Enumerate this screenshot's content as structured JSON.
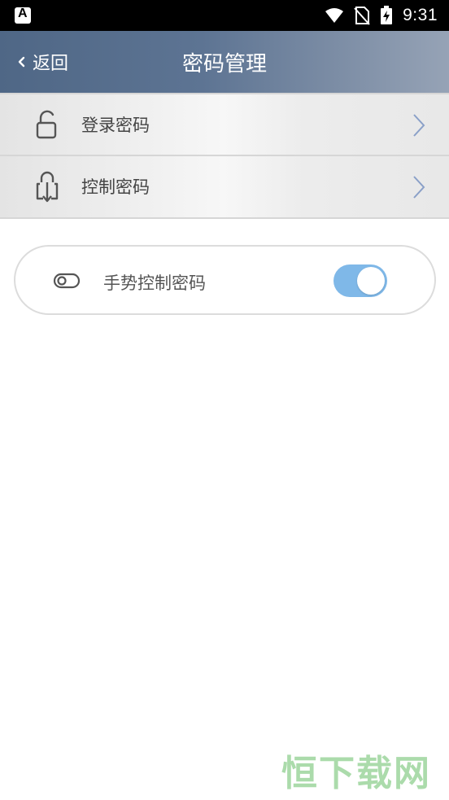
{
  "status_bar": {
    "time": "9:31",
    "left_icon": "app-notification-icon",
    "icons": [
      "wifi-icon",
      "no-sim-icon",
      "battery-charging-icon"
    ]
  },
  "nav": {
    "back_label": "返回",
    "title": "密码管理"
  },
  "list": {
    "items": [
      {
        "label": "登录密码",
        "icon": "unlock-icon"
      },
      {
        "label": "控制密码",
        "icon": "lock-download-icon"
      }
    ]
  },
  "gesture": {
    "label": "手势控制密码",
    "icon": "toggle-outline-icon",
    "enabled": true,
    "switch_color": "#7fb8e8"
  },
  "watermark": {
    "text": "恒下载网"
  }
}
